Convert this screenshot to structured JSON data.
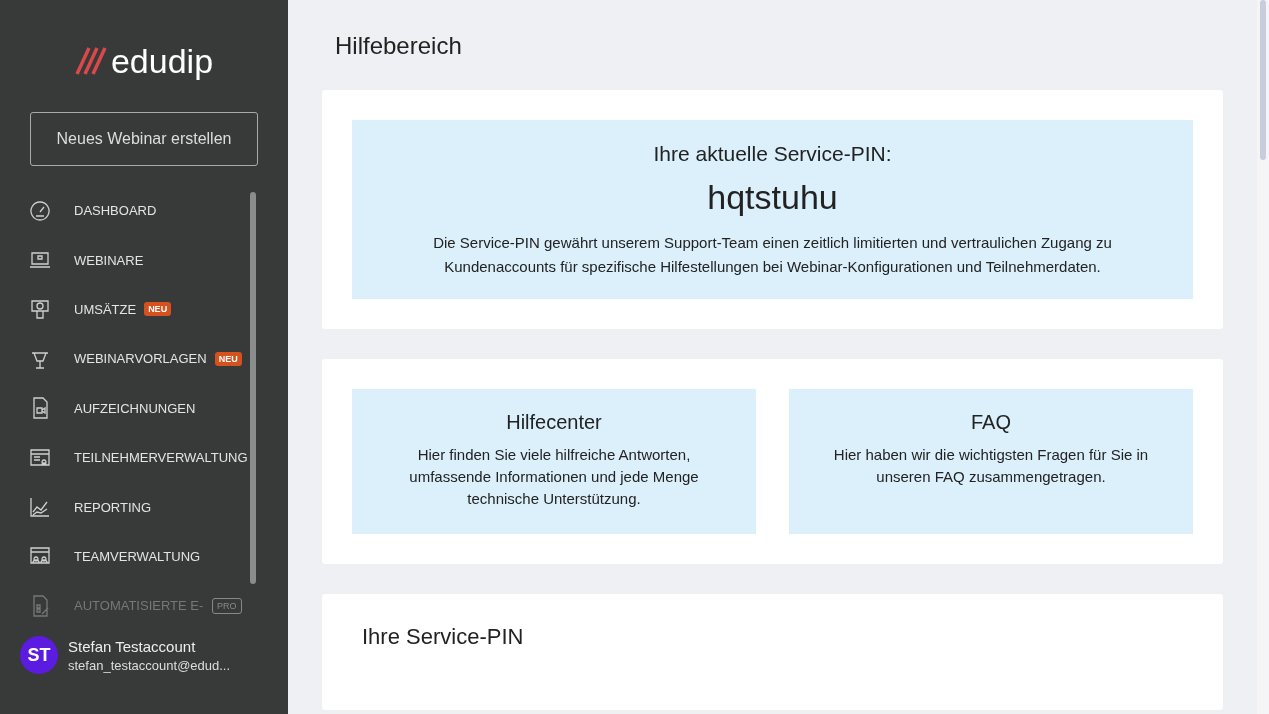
{
  "sidebar": {
    "logo": "edudip",
    "create_button": "Neues Webinar erstellen",
    "items": [
      {
        "label": "DASHBOARD",
        "disabled": false
      },
      {
        "label": "WEBINARE",
        "disabled": false
      },
      {
        "label": "UMSÄTZE",
        "disabled": false,
        "badge": {
          "text": "NEU",
          "kind": "new"
        }
      },
      {
        "label": "WEBINARVORLAGEN",
        "disabled": false,
        "badge": {
          "text": "NEU",
          "kind": "new"
        }
      },
      {
        "label": "AUFZEICHNUNGEN",
        "disabled": false
      },
      {
        "label": "TEILNEHMERVERWALTUNG",
        "disabled": false
      },
      {
        "label": "REPORTING",
        "disabled": false
      },
      {
        "label": "TEAMVERWALTUNG",
        "disabled": false
      },
      {
        "label": "AUTOMATISIERTE E-",
        "disabled": true,
        "badge": {
          "text": "PRO",
          "kind": "pro"
        }
      }
    ],
    "user": {
      "initials": "ST",
      "name": "Stefan Testaccount",
      "email": "stefan_testaccount@edud..."
    }
  },
  "page_title": "Hilfebereich",
  "pin_card": {
    "heading": "Ihre aktuelle Service-PIN:",
    "pin": "hqtstuhu",
    "description": "Die Service-PIN gewährt unserem Support-Team einen zeitlich limitierten und vertraulichen Zugang zu Kundenaccounts für spezifische Hilfestellungen bei Webinar-Konfigurationen und Teilnehmerdaten."
  },
  "help_links": [
    {
      "title": "Hilfecenter",
      "text": "Hier finden Sie viele hilfreiche Antworten, umfassende Informationen und jede Menge technische Unterstützung."
    },
    {
      "title": "FAQ",
      "text": "Hier haben wir die wichtigsten Fragen für Sie in unseren FAQ zusammengetragen."
    }
  ],
  "service_pin_section": {
    "title": "Ihre Service-PIN"
  }
}
